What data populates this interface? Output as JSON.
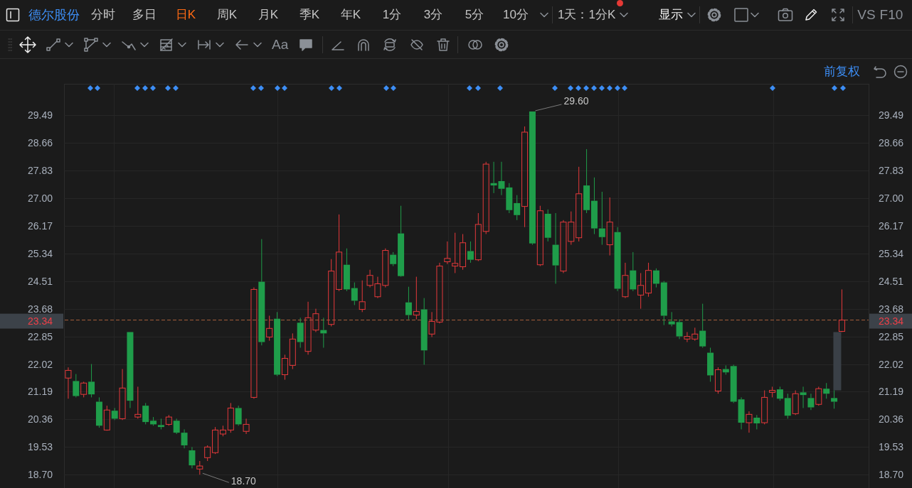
{
  "toolbar": {
    "stock_name": "德尔股份",
    "periods": [
      {
        "label": "分时",
        "selected": false
      },
      {
        "label": "多日",
        "selected": false
      },
      {
        "label": "日K",
        "selected": true
      },
      {
        "label": "周K",
        "selected": false
      },
      {
        "label": "月K",
        "selected": false
      },
      {
        "label": "季K",
        "selected": false
      },
      {
        "label": "年K",
        "selected": false
      },
      {
        "label": "1分",
        "selected": false
      },
      {
        "label": "3分",
        "selected": false
      },
      {
        "label": "5分",
        "selected": false
      },
      {
        "label": "10分",
        "selected": false
      }
    ],
    "interval_selector": {
      "label": "1天：1分K",
      "notification": true
    },
    "display_menu": {
      "label": "显示"
    },
    "compare_button": "VS",
    "f10_button": "F10"
  },
  "drawing_toolbar": {
    "text_tool": "Aa"
  },
  "chart": {
    "adjustment": "前复权",
    "left_axis": {
      "current_price": "23.34"
    },
    "right_axis": {
      "labels": [
        "29.49",
        "28.66",
        "27.83",
        "27.00",
        "26.17",
        "25.34",
        "24.51",
        "23.68",
        "22.85",
        "22.02",
        "21.19",
        "20.36",
        "19.53",
        "18.70"
      ],
      "current_price": "23.34"
    },
    "high_label": "29.60",
    "low_label": "18.70",
    "chart_data": {
      "type": "candlestick",
      "categories": [
        null,
        null,
        null,
        null,
        null,
        null,
        null,
        null,
        null,
        null,
        null,
        null,
        null,
        null,
        null,
        null,
        null,
        null,
        null,
        null,
        null,
        null,
        null,
        null,
        null,
        null,
        null,
        null,
        null,
        null,
        null,
        null,
        null,
        null,
        null,
        null,
        null,
        null,
        null,
        null,
        null,
        null,
        null,
        null,
        null,
        null,
        null,
        null,
        null,
        null,
        null,
        null,
        null,
        null,
        null,
        null,
        null,
        null,
        null,
        null,
        null,
        null,
        null,
        null,
        null,
        null,
        null,
        null,
        null,
        null,
        null,
        null,
        null,
        null,
        null,
        null,
        null,
        null,
        null,
        null,
        null,
        null,
        null,
        null,
        null,
        null,
        null,
        null,
        null,
        null,
        null,
        null,
        null,
        null,
        null,
        null,
        null,
        null,
        null,
        null,
        null,
        null,
        null,
        null
      ],
      "ylim": [
        18.3,
        30.43
      ],
      "grid": true,
      "yticks": [
        29.49,
        28.66,
        27.83,
        {
          "value": 27,
          "label": "27.00"
        },
        26.17,
        25.34,
        24.51,
        23.68,
        22.85,
        22.02,
        21.19,
        20.36,
        19.53,
        {
          "value": 18.7,
          "label": "18.70"
        }
      ],
      "ref_lines": [
        {
          "axis": "y",
          "value": 23.34
        }
      ],
      "ohlc": [
        [
          21.6,
          21.92,
          20.98,
          21.83
        ],
        [
          21.51,
          21.72,
          21.02,
          21.06
        ],
        [
          21.11,
          21.49,
          21.02,
          21.45
        ],
        [
          21.49,
          22.02,
          21.02,
          21.11
        ],
        [
          20.89,
          21.02,
          20.11,
          20.17
        ],
        [
          20.04,
          20.77,
          20.02,
          20.64
        ],
        [
          20.62,
          20.7,
          20.34,
          20.38
        ],
        [
          20.38,
          21.87,
          20.34,
          21.3
        ],
        [
          22.98,
          22.98,
          20.7,
          20.92
        ],
        [
          20.43,
          21.34,
          20.38,
          20.51
        ],
        [
          20.77,
          20.85,
          20.21,
          20.28
        ],
        [
          20.32,
          20.43,
          20.17,
          20.21
        ],
        [
          20.19,
          20.38,
          20.06,
          20.13
        ],
        [
          20.21,
          20.49,
          20.17,
          20.43
        ],
        [
          20.32,
          20.38,
          19.92,
          19.96
        ],
        [
          19.96,
          20.06,
          19.49,
          19.58
        ],
        [
          19.43,
          19.53,
          18.89,
          18.98
        ],
        [
          18.87,
          19.11,
          18.7,
          18.96
        ],
        [
          19.21,
          19.58,
          19.11,
          19.53
        ],
        [
          19.36,
          20.13,
          19.32,
          20.04
        ],
        [
          19.92,
          20.17,
          19.85,
          20.04
        ],
        [
          20.04,
          20.85,
          19.96,
          20.7
        ],
        [
          20.7,
          20.77,
          20.17,
          20.21
        ],
        [
          20.0,
          20.38,
          19.92,
          20.21
        ],
        [
          21.02,
          24.32,
          20.98,
          24.26
        ],
        [
          24.49,
          25.77,
          22.58,
          22.68
        ],
        [
          22.83,
          23.47,
          22.72,
          23.09
        ],
        [
          23.38,
          23.58,
          21.66,
          21.7
        ],
        [
          21.7,
          22.3,
          21.55,
          22.19
        ],
        [
          21.98,
          22.94,
          21.87,
          22.77
        ],
        [
          23.26,
          23.41,
          22.51,
          22.68
        ],
        [
          22.4,
          23.89,
          22.3,
          23.41
        ],
        [
          23.04,
          23.68,
          22.98,
          23.53
        ],
        [
          23.04,
          23.41,
          22.51,
          22.94
        ],
        [
          23.21,
          25.17,
          23.15,
          24.81
        ],
        [
          24.26,
          26.51,
          24.21,
          25.38
        ],
        [
          25.0,
          25.49,
          24.21,
          24.26
        ],
        [
          24.3,
          24.47,
          23.79,
          23.92
        ],
        [
          23.66,
          24.53,
          23.58,
          23.89
        ],
        [
          24.38,
          24.85,
          24.32,
          24.68
        ],
        [
          24.04,
          24.64,
          24.0,
          24.43
        ],
        [
          24.38,
          25.49,
          24.32,
          25.43
        ],
        [
          25.3,
          25.38,
          24.96,
          25.02
        ],
        [
          25.94,
          26.77,
          24.64,
          24.66
        ],
        [
          23.87,
          24.34,
          23.36,
          23.49
        ],
        [
          23.49,
          24.64,
          23.36,
          23.6
        ],
        [
          23.66,
          24.0,
          22.0,
          22.43
        ],
        [
          22.92,
          23.58,
          22.83,
          23.3
        ],
        [
          23.28,
          25.06,
          23.24,
          24.96
        ],
        [
          25.09,
          25.7,
          25.02,
          25.19
        ],
        [
          24.96,
          25.96,
          24.75,
          25.04
        ],
        [
          24.94,
          25.92,
          24.85,
          25.66
        ],
        [
          25.41,
          25.7,
          25.06,
          25.15
        ],
        [
          25.15,
          26.55,
          25.11,
          26.21
        ],
        [
          26.0,
          28.09,
          25.92,
          28.02
        ],
        [
          27.45,
          28.09,
          27.15,
          27.38
        ],
        [
          27.51,
          28.09,
          27.09,
          27.28
        ],
        [
          27.32,
          27.45,
          26.55,
          26.64
        ],
        [
          26.85,
          27.09,
          26.34,
          26.49
        ],
        [
          26.75,
          29.15,
          26.13,
          28.98
        ],
        [
          29.6,
          29.6,
          25.6,
          25.64
        ],
        [
          25.0,
          26.77,
          24.96,
          26.62
        ],
        [
          26.53,
          26.66,
          25.7,
          25.81
        ],
        [
          25.6,
          26.55,
          24.43,
          24.98
        ],
        [
          24.81,
          26.34,
          24.75,
          26.28
        ],
        [
          25.7,
          26.6,
          25.6,
          26.28
        ],
        [
          25.81,
          27.94,
          25.7,
          27.13
        ],
        [
          27.38,
          28.47,
          26.55,
          26.64
        ],
        [
          26.92,
          27.62,
          25.92,
          26.09
        ],
        [
          26.09,
          27.19,
          25.6,
          25.83
        ],
        [
          25.6,
          27.02,
          25.28,
          26.28
        ],
        [
          25.98,
          26.13,
          24.21,
          24.28
        ],
        [
          24.04,
          25.06,
          24.0,
          24.68
        ],
        [
          24.83,
          25.38,
          24.21,
          24.26
        ],
        [
          24.09,
          24.75,
          23.68,
          24.38
        ],
        [
          24.15,
          25.06,
          24.04,
          24.83
        ],
        [
          24.83,
          24.89,
          24.32,
          24.43
        ],
        [
          24.47,
          24.51,
          23.19,
          23.47
        ],
        [
          23.3,
          23.58,
          23.15,
          23.21
        ],
        [
          23.28,
          23.36,
          22.77,
          22.85
        ],
        [
          22.77,
          22.98,
          22.68,
          22.85
        ],
        [
          22.77,
          23.11,
          22.72,
          22.92
        ],
        [
          23.02,
          23.83,
          22.51,
          22.55
        ],
        [
          22.36,
          22.51,
          21.49,
          21.68
        ],
        [
          21.21,
          21.92,
          21.13,
          21.85
        ],
        [
          21.87,
          21.98,
          21.7,
          21.77
        ],
        [
          21.96,
          22.0,
          20.85,
          20.89
        ],
        [
          20.96,
          21.02,
          20.06,
          20.26
        ],
        [
          20.26,
          20.6,
          19.96,
          20.51
        ],
        [
          20.41,
          20.49,
          20.06,
          20.24
        ],
        [
          20.26,
          21.23,
          20.21,
          21.02
        ],
        [
          21.17,
          21.34,
          21.02,
          21.23
        ],
        [
          21.26,
          21.34,
          20.92,
          20.98
        ],
        [
          21.0,
          21.13,
          20.38,
          20.47
        ],
        [
          20.53,
          21.23,
          20.49,
          21.13
        ],
        [
          21.17,
          21.34,
          20.7,
          21.09
        ],
        [
          21.0,
          21.13,
          20.64,
          20.72
        ],
        [
          20.81,
          21.34,
          20.77,
          21.28
        ],
        [
          21.28,
          21.45,
          20.98,
          21.13
        ],
        [
          21.0,
          21.23,
          20.68,
          20.89
        ],
        [
          23.0,
          24.26,
          22.98,
          23.34
        ],
        null,
        null,
        null
      ]
    }
  }
}
